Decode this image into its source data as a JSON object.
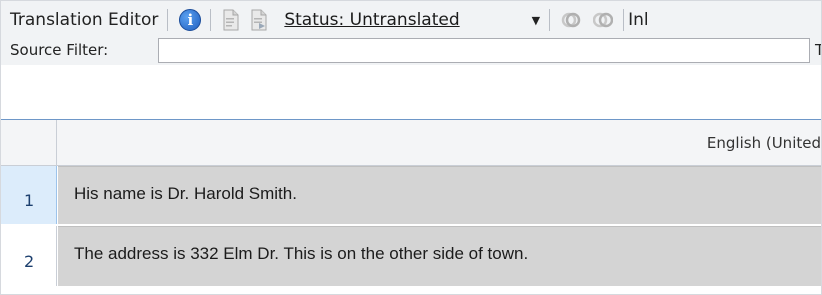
{
  "toolbar": {
    "title": "Translation Editor",
    "status_label": "Status: Untranslated",
    "trailing_text": "Inl",
    "icons": [
      "info-icon",
      "document-export-icon",
      "document-import-icon",
      "merge-ring-icon",
      "split-ring-icon",
      "chevron-down-icon"
    ]
  },
  "filter": {
    "label": "Source Filter:",
    "value": "",
    "trailing_text": "Ta"
  },
  "grid": {
    "column_header": "English (United",
    "rows": [
      {
        "number": "1",
        "source": "His name is Dr. Harold Smith."
      },
      {
        "number": "2",
        "source": "The address is 332 Elm Dr. This is on the other side of town."
      }
    ]
  },
  "colors": {
    "segment_background": "#d4d4d4",
    "active_row_number_background": "#dcecfb",
    "toolbar_background": "#f1f3f5",
    "divider_blue": "#6e97c8",
    "info_icon_blue": "#1f5fbf"
  }
}
